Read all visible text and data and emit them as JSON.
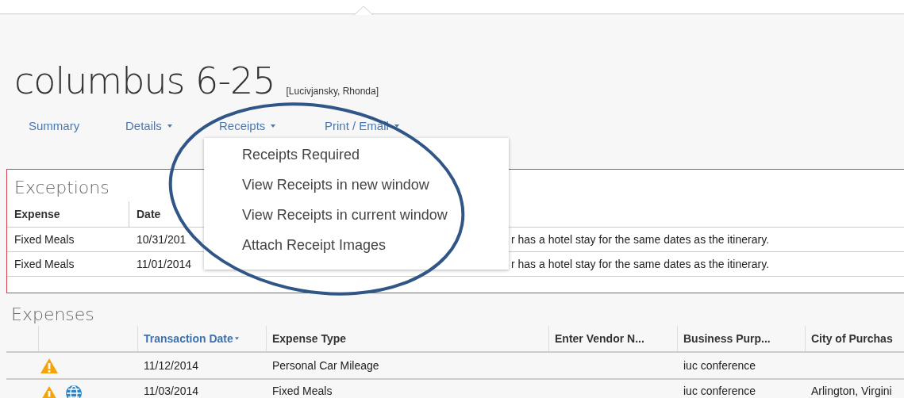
{
  "title": "columbus 6-25",
  "subtitle": "[Lucivjansky, Rhonda]",
  "nav": [
    {
      "label": "Summary",
      "dropdown": false
    },
    {
      "label": "Details",
      "dropdown": true
    },
    {
      "label": "Receipts",
      "dropdown": true,
      "menu": [
        "Receipts Required",
        "View Receipts in new window",
        "View Receipts in current window",
        "Attach Receipt Images"
      ]
    },
    {
      "label": "Print / Email",
      "dropdown": true
    }
  ],
  "exceptions": {
    "title": "Exceptions",
    "columns": [
      "Expense",
      "Date"
    ],
    "rows": [
      {
        "expense": "Fixed Meals",
        "date": "10/31/201",
        "message": "r has a hotel stay for the same dates as the itinerary."
      },
      {
        "expense": "Fixed Meals",
        "date": "11/01/2014",
        "message": "r has a hotel stay for the same dates as the itinerary."
      }
    ]
  },
  "expenses": {
    "title": "Expenses",
    "columns": [
      {
        "label": "Transaction Date",
        "sorted": true
      },
      {
        "label": "Expense Type",
        "sorted": false
      },
      {
        "label": "Enter Vendor N...",
        "sorted": false
      },
      {
        "label": "Business Purp...",
        "sorted": false
      },
      {
        "label": "City of Purchas",
        "sorted": false
      }
    ],
    "rows": [
      {
        "warning": true,
        "international": false,
        "date": "11/12/2014",
        "expense_type": "Personal Car Mileage",
        "purpose": "iuc conference"
      },
      {
        "warning": true,
        "international": true,
        "date": "11/03/2014",
        "expense_type": "Fixed Meals",
        "purpose": "iuc conference",
        "city": "Arlington, Virgini"
      }
    ]
  },
  "annotation": {
    "kind": "ellipse"
  }
}
